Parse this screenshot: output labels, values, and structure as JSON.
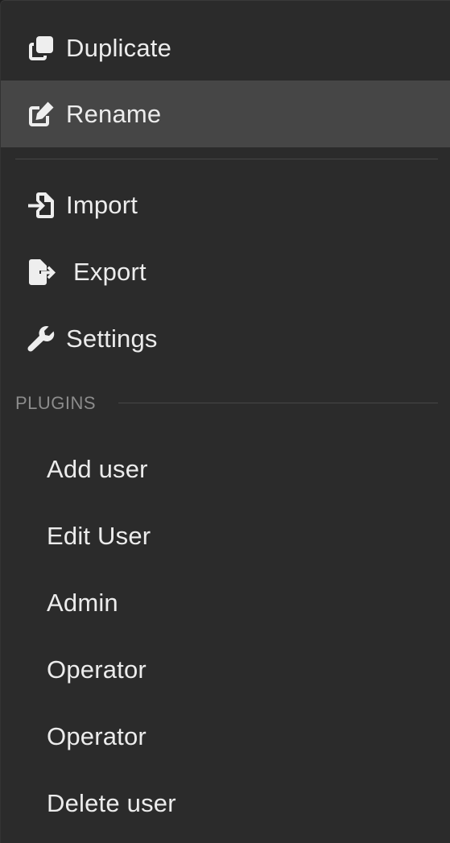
{
  "menu": {
    "items": [
      {
        "label": "Duplicate",
        "icon": "duplicate-icon"
      },
      {
        "label": "Rename",
        "icon": "edit-icon",
        "highlighted": true
      },
      {
        "label": "Import",
        "icon": "file-import-icon"
      },
      {
        "label": "Export",
        "icon": "file-export-icon"
      },
      {
        "label": "Settings",
        "icon": "wrench-icon"
      }
    ],
    "section_title": "PLUGINS",
    "plugins": [
      {
        "label": "Add user"
      },
      {
        "label": "Edit User"
      },
      {
        "label": "Admin"
      },
      {
        "label": "Operator"
      },
      {
        "label": "Operator"
      },
      {
        "label": "Delete user"
      }
    ]
  },
  "colors": {
    "background": "#2b2b2b",
    "highlight": "#464646",
    "text": "#ececec",
    "section_text": "#8c8c8c",
    "divider": "#474747"
  }
}
